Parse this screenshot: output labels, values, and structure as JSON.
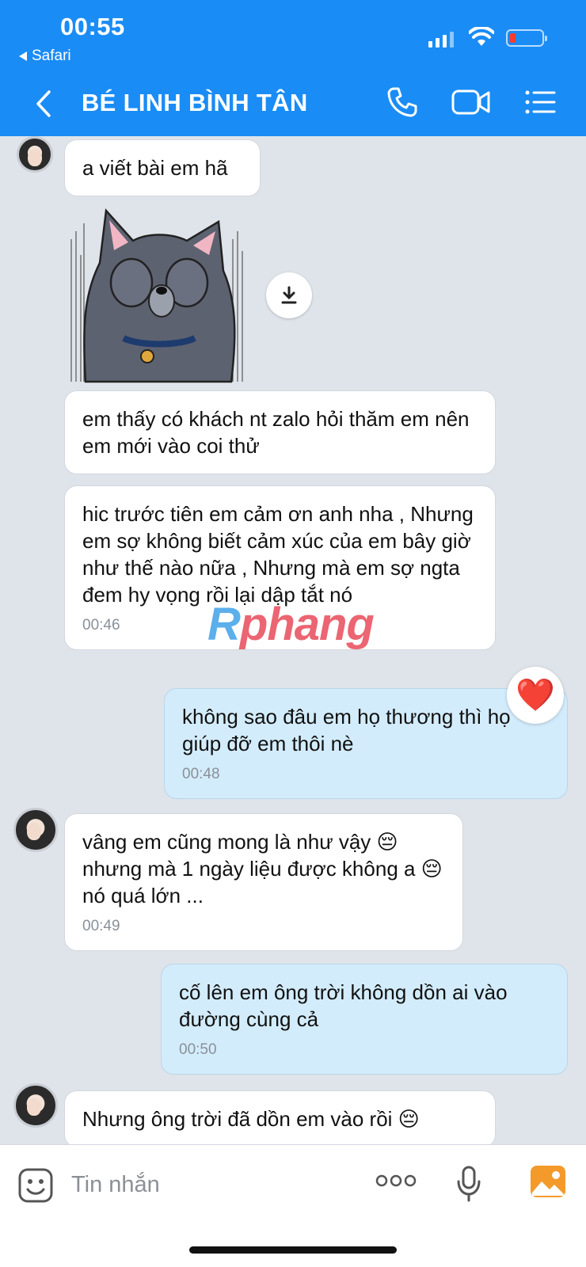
{
  "status_bar": {
    "time": "00:55",
    "back_app": "Safari",
    "signal_icon": "cellular-signal-icon",
    "wifi_icon": "wifi-icon",
    "battery_icon": "battery-low-icon",
    "battery_color": "#ff3b30"
  },
  "header": {
    "contact_name": "BÉ LINH BÌNH TÂN",
    "back_icon": "chevron-left-icon",
    "call_icon": "phone-icon",
    "video_icon": "video-camera-icon",
    "menu_icon": "list-menu-icon",
    "bg_color": "#1a8cf5"
  },
  "messages": [
    {
      "text": "a viết bài em hã",
      "time": ""
    },
    {
      "text": "em thấy có khách nt zalo hỏi thăm em nên em mới vào coi thử",
      "time": ""
    },
    {
      "text": "hic trước tiên em cảm ơn anh nha , Nhưng em sợ không biết cảm xúc của em bây giờ như thế nào nữa , Nhưng mà em sợ ngta đem hy vọng rồi lại dập tắt nó",
      "time": "00:46"
    },
    {
      "text": "không sao đâu em họ thương thì họ giúp đỡ em thôi nè",
      "time": "00:48"
    },
    {
      "text": "vâng em cũng mong là như vậy 😔 nhưng mà 1 ngày liệu được không a 😔 nó quá lớn ...",
      "time": "00:49"
    },
    {
      "text": "cố lên em ông trời không dồn ai vào đường cùng cả",
      "time": "00:50"
    },
    {
      "text": "Nhưng ông trời đã dồn em vào rồi 😔",
      "time": ""
    }
  ],
  "watermark": {
    "part1": "R",
    "part2": "phang"
  },
  "reaction": "❤️",
  "composer": {
    "placeholder": "Tin nhắn",
    "emoji_icon": "emoji-sticker-icon",
    "more_icon": "more-dots-icon",
    "mic_icon": "microphone-icon",
    "image_icon": "image-gallery-icon",
    "accent_color": "#f39a2a"
  }
}
